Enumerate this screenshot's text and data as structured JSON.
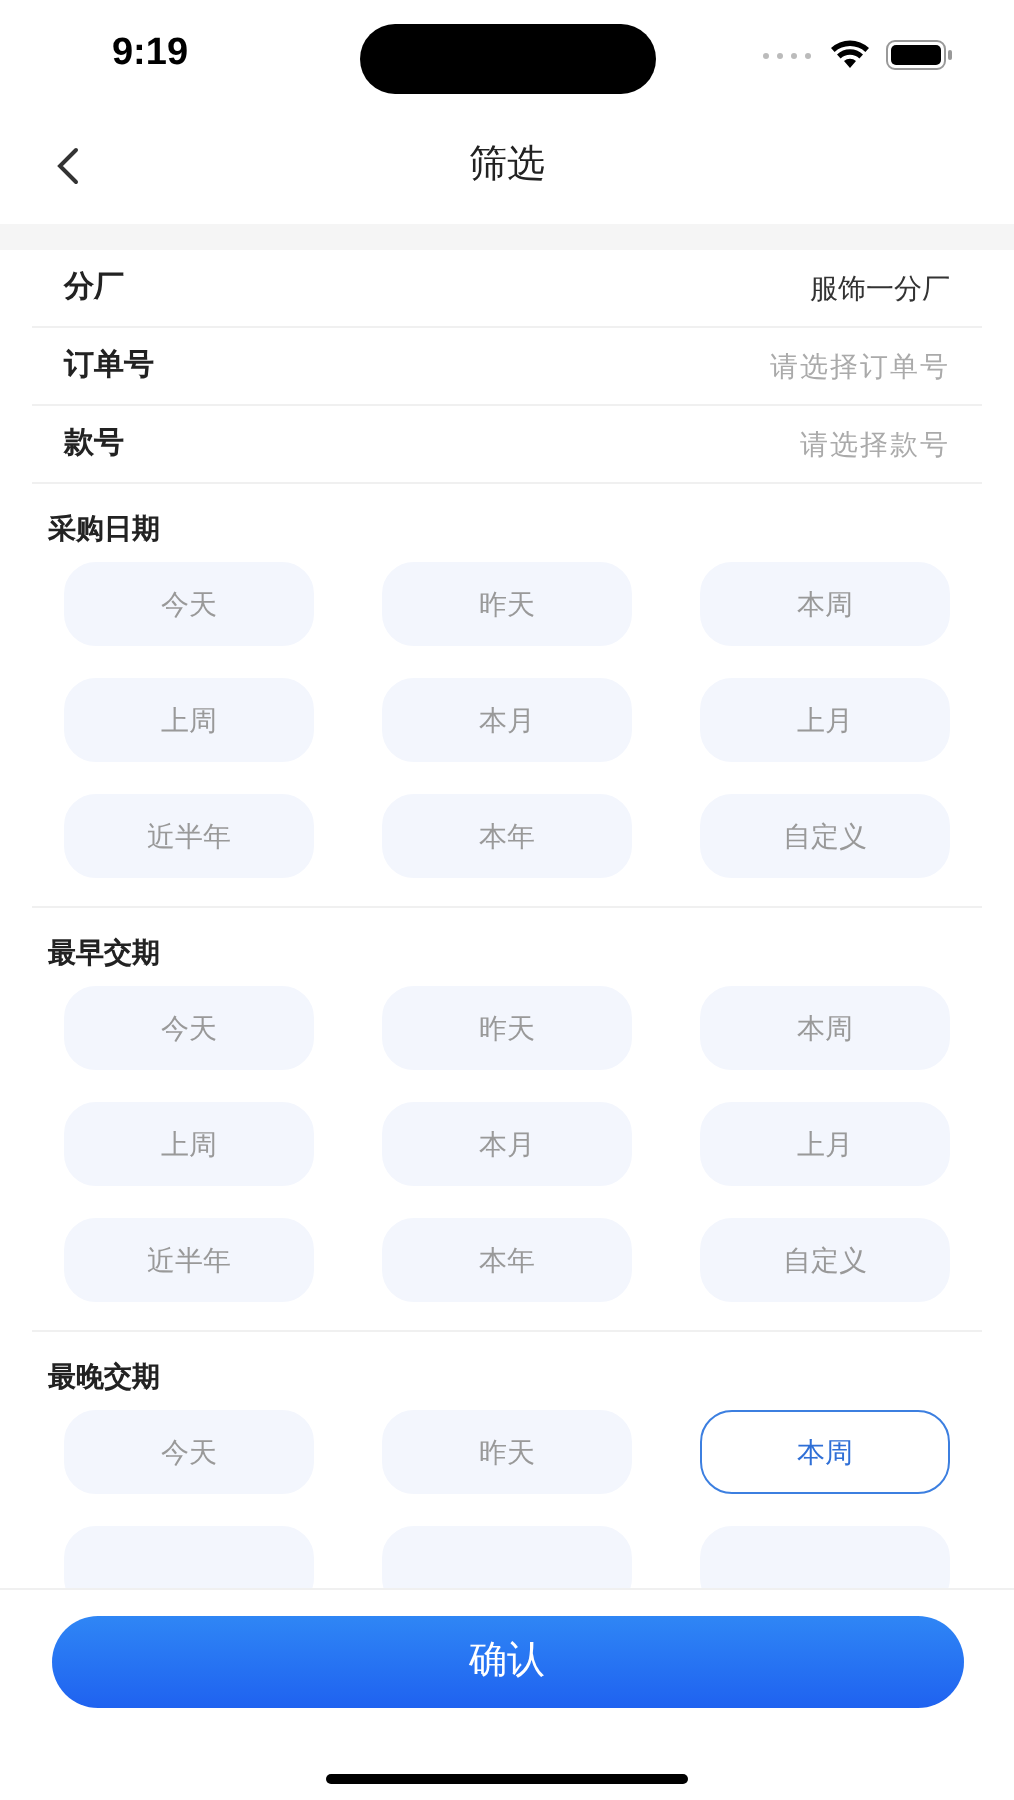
{
  "status_bar": {
    "time": "9:19"
  },
  "nav": {
    "title": "筛选"
  },
  "fields": [
    {
      "label": "分厂",
      "value": "服饰一分厂"
    },
    {
      "label": "订单号",
      "placeholder": "请选择订单号"
    },
    {
      "label": "款号",
      "placeholder": "请选择款号"
    }
  ],
  "groups": [
    {
      "title": "采购日期",
      "options": [
        {
          "label": "今天",
          "selected": false
        },
        {
          "label": "昨天",
          "selected": false
        },
        {
          "label": "本周",
          "selected": false
        },
        {
          "label": "上周",
          "selected": false
        },
        {
          "label": "本月",
          "selected": false
        },
        {
          "label": "上月",
          "selected": false
        },
        {
          "label": "近半年",
          "selected": false
        },
        {
          "label": "本年",
          "selected": false
        },
        {
          "label": "自定义",
          "selected": false
        }
      ]
    },
    {
      "title": "最早交期",
      "options": [
        {
          "label": "今天",
          "selected": false
        },
        {
          "label": "昨天",
          "selected": false
        },
        {
          "label": "本周",
          "selected": false
        },
        {
          "label": "上周",
          "selected": false
        },
        {
          "label": "本月",
          "selected": false
        },
        {
          "label": "上月",
          "selected": false
        },
        {
          "label": "近半年",
          "selected": false
        },
        {
          "label": "本年",
          "selected": false
        },
        {
          "label": "自定义",
          "selected": false
        }
      ]
    },
    {
      "title": "最晚交期",
      "options": [
        {
          "label": "今天",
          "selected": false
        },
        {
          "label": "昨天",
          "selected": false
        },
        {
          "label": "本周",
          "selected": true
        },
        {
          "selected": false
        },
        {
          "selected": false
        },
        {
          "selected": false
        }
      ]
    }
  ],
  "confirm_button": "确认"
}
